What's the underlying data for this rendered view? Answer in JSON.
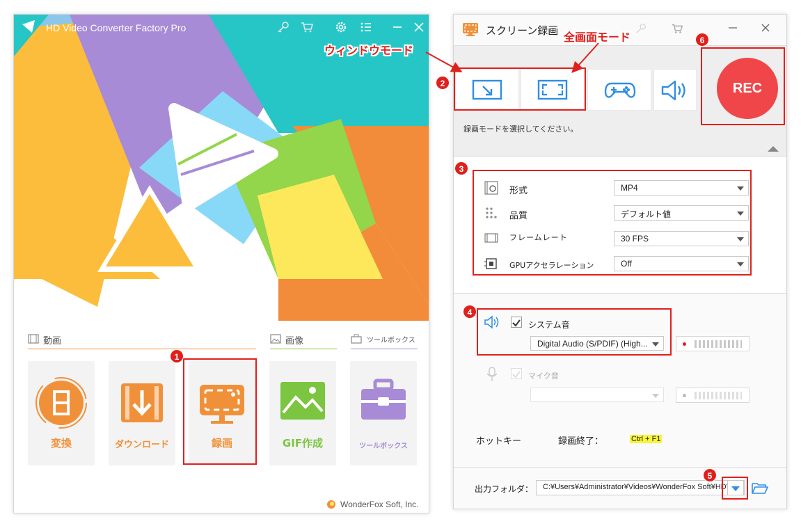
{
  "left_window": {
    "title": "HD Video Converter Factory Pro",
    "title_icons": [
      "key-icon",
      "cart-icon",
      "gear-icon",
      "menu-icon",
      "minimize-icon",
      "close-icon"
    ],
    "sections": {
      "video": "動画",
      "image": "画像",
      "toolbox": "ツールボックス"
    },
    "tiles": [
      {
        "label": "変換",
        "icon": "convert-film-icon"
      },
      {
        "label": "ダウンロード",
        "icon": "download-icon"
      },
      {
        "label": "録画",
        "icon": "screen-record-icon"
      },
      {
        "label": "GIF作成",
        "icon": "gif-image-icon"
      },
      {
        "label": "ツールボックス",
        "icon": "toolbox-icon"
      }
    ],
    "footer": "WonderFox Soft, Inc.",
    "accent": "#f0913a"
  },
  "right_window": {
    "title": "スクリーン録画",
    "mode_hint": "録画モードを選択してください。",
    "rec_label": "REC",
    "rec_color": "#f0464a",
    "settings": [
      {
        "label": "形式",
        "value": "MP4",
        "icon": "format-icon"
      },
      {
        "label": "品質",
        "value": "デフォルト値",
        "icon": "quality-icon"
      },
      {
        "label": "フレームレート",
        "value": "30 FPS",
        "icon": "framerate-icon"
      },
      {
        "label": "GPUアクセラレーション",
        "value": "Off",
        "icon": "gpu-icon"
      }
    ],
    "system_audio": {
      "label": "システム音",
      "device": "Digital Audio (S/PDIF) (High..."
    },
    "mic_audio": {
      "label": "マイク音",
      "device": ""
    },
    "hotkey": {
      "label": "ホットキー",
      "action": "録画終了：",
      "key": "Ctrl + F1"
    },
    "output": {
      "label": "出力フォルダ：",
      "path": "C:¥Users¥Administrator¥Videos¥WonderFox Soft¥HDV"
    }
  },
  "annotations": {
    "window_mode": "ウィンドウモード",
    "fullscreen_mode": "全画面モード",
    "badges": [
      "1",
      "2",
      "3",
      "4",
      "5",
      "6"
    ]
  }
}
